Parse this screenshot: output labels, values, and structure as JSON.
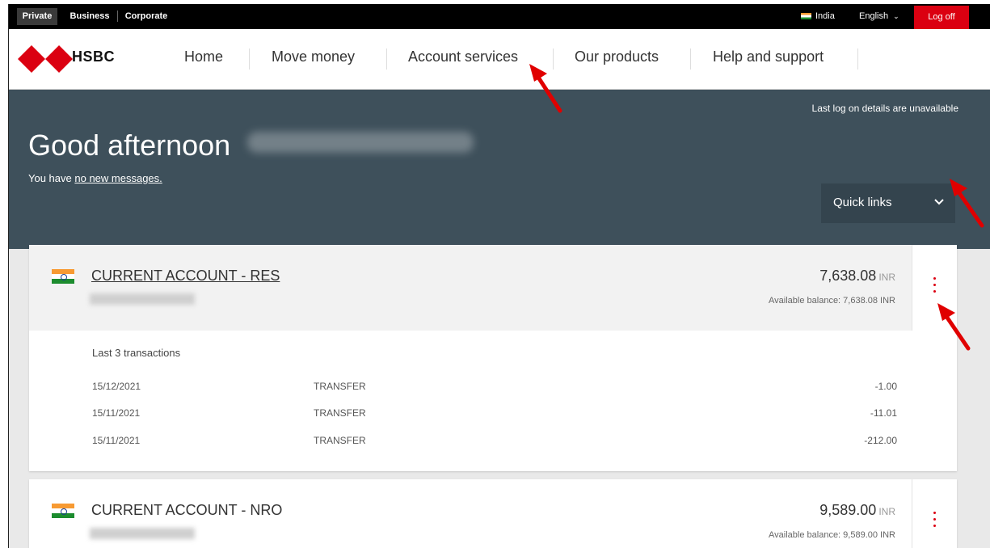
{
  "topbar": {
    "segments": [
      "Private",
      "Business",
      "Corporate"
    ],
    "country": "India",
    "language": "English",
    "logoff": "Log off"
  },
  "brand": {
    "name": "HSBC"
  },
  "nav": {
    "items": [
      "Home",
      "Move money",
      "Account services",
      "Our products",
      "Help and support"
    ]
  },
  "hero": {
    "last_logon": "Last log on details are unavailable",
    "greeting": "Good afternoon",
    "messages_prefix": "You have",
    "messages_link": "no new messages.",
    "quick_links": "Quick links"
  },
  "accounts": [
    {
      "name": "CURRENT ACCOUNT - RES",
      "balance": "7,638.08",
      "currency": "INR",
      "available": "Available balance: 7,638.08 INR",
      "tx_title": "Last 3 transactions",
      "transactions": [
        {
          "date": "15/12/2021",
          "type": "TRANSFER",
          "amount": "-1.00"
        },
        {
          "date": "15/11/2021",
          "type": "TRANSFER",
          "amount": "-11.01"
        },
        {
          "date": "15/11/2021",
          "type": "TRANSFER",
          "amount": "-212.00"
        }
      ]
    },
    {
      "name": "CURRENT ACCOUNT - NRO",
      "balance": "9,589.00",
      "currency": "INR",
      "available": "Available balance: 9,589.00 INR"
    }
  ],
  "colors": {
    "brand_red": "#db0011",
    "hero_bg": "#3e505b",
    "annotation_red": "#e00000"
  },
  "icons": [
    "hsbc-logo-icon",
    "india-flag-icon",
    "chevron-down-icon",
    "more-options-icon",
    "arrow-annotation-icon"
  ]
}
